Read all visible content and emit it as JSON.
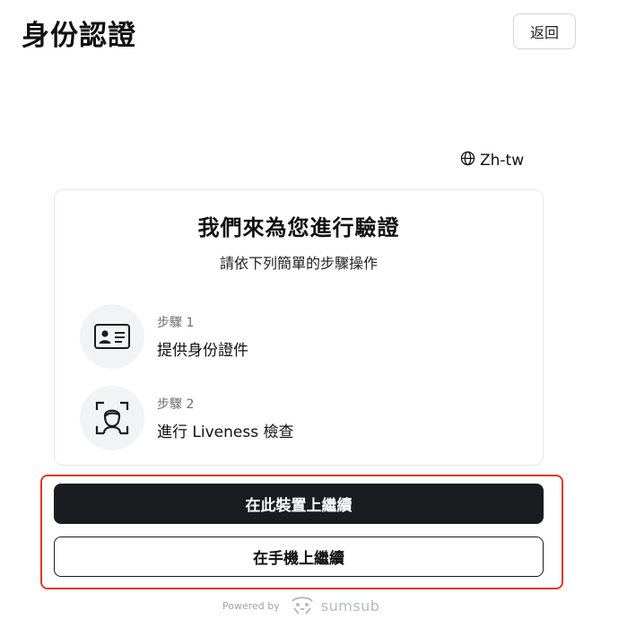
{
  "header": {
    "title": "身份認證",
    "back_label": "返回"
  },
  "language": {
    "label": "Zh-tw",
    "icon": "globe-icon"
  },
  "card": {
    "title": "我們來為您進行驗證",
    "subtitle": "請依下列簡單的步驟操作",
    "steps": [
      {
        "label": "步驟 1",
        "text": "提供身份證件",
        "icon": "id-card-icon"
      },
      {
        "label": "步驟 2",
        "text": "進行 Liveness 檢查",
        "icon": "face-scan-icon"
      }
    ]
  },
  "actions": {
    "primary_label": "在此裝置上繼續",
    "secondary_label": "在手機上繼續"
  },
  "footer": {
    "powered_by": "Powered by",
    "brand": "sumsub"
  },
  "colors": {
    "primary_button": "#1b1c1f",
    "highlight_frame": "#d93a2b",
    "step_circle": "#f2f3f5"
  }
}
